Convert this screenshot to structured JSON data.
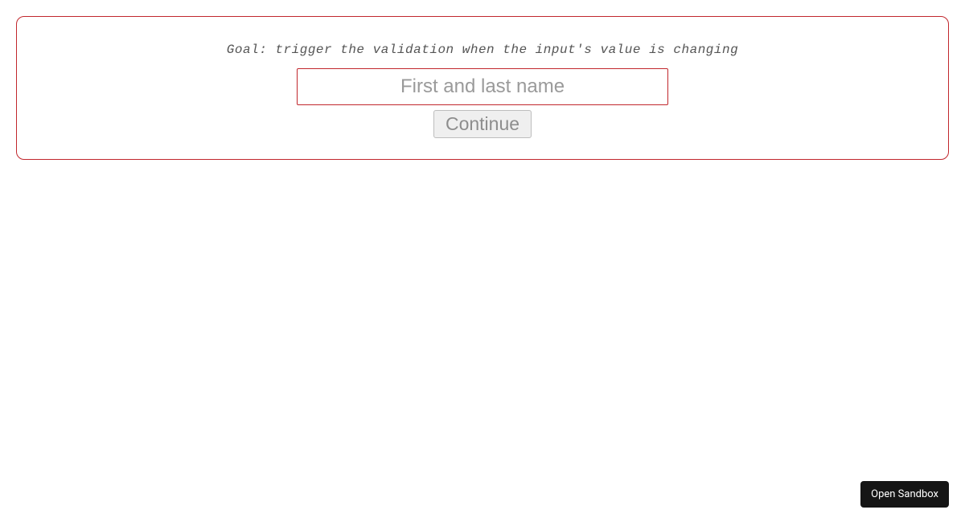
{
  "goal_text": "Goal: trigger the validation when the input's value is changing",
  "form": {
    "name_placeholder": "First and last name",
    "name_value": "",
    "continue_label": "Continue"
  },
  "sandbox": {
    "open_label": "Open Sandbox"
  },
  "colors": {
    "border_red": "#c1272d"
  }
}
